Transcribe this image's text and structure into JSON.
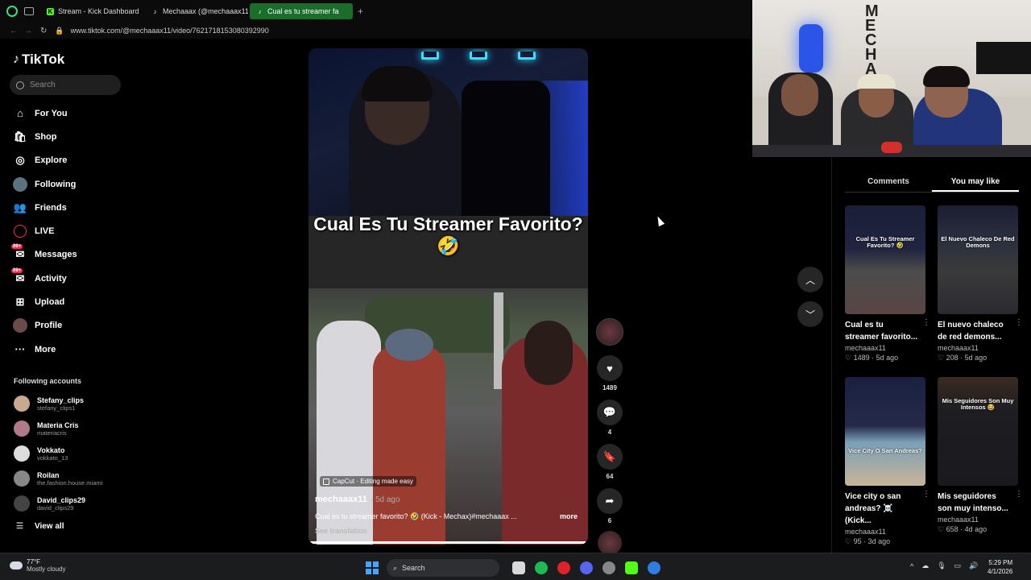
{
  "browser": {
    "tabs": [
      {
        "label": "Stream - Kick Dashboard",
        "icon": "kick-icon",
        "active": false
      },
      {
        "label": "Mechaaax (@mechaaax11)",
        "icon": "tiktok-icon",
        "active": false
      },
      {
        "label": "Cual es tu streamer fa",
        "icon": "tiktok-icon",
        "active": true
      }
    ],
    "url": "www.tiktok.com/@mechaaax11/video/7621718153080392990"
  },
  "tiktok": {
    "logo": "TikTok",
    "search_placeholder": "Search",
    "nav": [
      {
        "label": "For You",
        "icon": "home-icon",
        "badge": ""
      },
      {
        "label": "Shop",
        "icon": "shop-icon",
        "badge": ""
      },
      {
        "label": "Explore",
        "icon": "compass-icon",
        "badge": ""
      },
      {
        "label": "Following",
        "icon": "following-avatar-icon",
        "badge": ""
      },
      {
        "label": "Friends",
        "icon": "friends-icon",
        "badge": ""
      },
      {
        "label": "LIVE",
        "icon": "live-icon",
        "badge": ""
      },
      {
        "label": "Messages",
        "icon": "messages-icon",
        "badge": "99+"
      },
      {
        "label": "Activity",
        "icon": "activity-icon",
        "badge": "99+"
      },
      {
        "label": "Upload",
        "icon": "upload-icon",
        "badge": ""
      },
      {
        "label": "Profile",
        "icon": "profile-avatar-icon",
        "badge": ""
      },
      {
        "label": "More",
        "icon": "more-icon",
        "badge": ""
      }
    ],
    "following_title": "Following accounts",
    "accounts": [
      {
        "name": "Stefany_clips",
        "handle": "stefany_clips1"
      },
      {
        "name": "Materia Cris",
        "handle": "materiacris"
      },
      {
        "name": "Vokkato",
        "handle": "vokkato_13"
      },
      {
        "name": "Roilan",
        "handle": "the.fashion.house.miami"
      },
      {
        "name": "David_clips29",
        "handle": "david_clips29"
      }
    ],
    "view_all": "View all"
  },
  "video": {
    "overlay_text": "Cual Es Tu Streamer Favorito? 🤣",
    "capcut": "CapCut · Editing made easy",
    "author": "mechaaax11",
    "age": "· 5d ago",
    "description": "Cual es tu streamer favorito? 🤣 (Kick - Mechax)#mechaaax ...",
    "more": "more",
    "see_translation": "See translation",
    "progress": 0.99
  },
  "actions": {
    "likes": "1489",
    "comments": "4",
    "saves": "64",
    "shares": "6"
  },
  "right_panel": {
    "tabs": [
      "Comments",
      "You may like"
    ],
    "active_tab": "You may like",
    "cards": [
      {
        "thumb_text": "Cual Es Tu Streamer Favorito? 🤣",
        "title": "Cual es tu streamer favorito...",
        "author": "mechaaax11",
        "meta": "♡ 1489 · 5d ago"
      },
      {
        "thumb_text": "El Nuevo Chaleco De Red Demons",
        "title": "El nuevo chaleco de red demons...",
        "author": "mechaaax11",
        "meta": "♡ 208 · 5d ago"
      },
      {
        "thumb_text": "Vice City O San Andreas?",
        "title": "Vice city o san andreas? ☠️ (Kick...",
        "author": "mechaaax11",
        "meta": "♡ 95 · 3d ago"
      },
      {
        "thumb_text": "Mis Seguidores Son Muy Intensos 😂",
        "title": "Mis seguidores son muy intenso...",
        "author": "mechaaax11",
        "meta": "♡ 658 · 4d ago"
      }
    ]
  },
  "taskbar": {
    "temp": "77°F",
    "weather": "Mostly cloudy",
    "search": "Search",
    "time": "5:29 PM",
    "date": "4/1/2026"
  }
}
